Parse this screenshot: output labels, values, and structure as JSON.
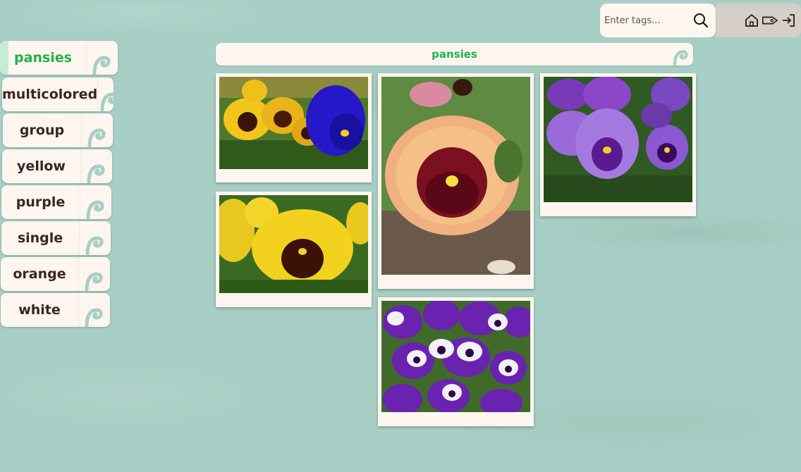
{
  "search": {
    "placeholder": "Enter tags..."
  },
  "toolbar": {
    "icons": [
      "home-icon",
      "tag-icon",
      "sign-in-icon"
    ]
  },
  "tags": [
    {
      "label": "pansies",
      "active": true
    },
    {
      "label": "multicolored",
      "active": false
    },
    {
      "label": "group",
      "active": false
    },
    {
      "label": "yellow",
      "active": false
    },
    {
      "label": "purple",
      "active": false
    },
    {
      "label": "single",
      "active": false
    },
    {
      "label": "orange",
      "active": false
    },
    {
      "label": "white",
      "active": false
    }
  ],
  "gallery": {
    "title": "pansies",
    "photos": [
      {
        "subject": "multicolored pansies yellow and blue"
      },
      {
        "subject": "yellow pansy"
      },
      {
        "subject": "orange peach pansy single"
      },
      {
        "subject": "group of purple and white pansies"
      },
      {
        "subject": "purple pansies"
      }
    ]
  },
  "colors": {
    "background": "#a8cfc5",
    "card": "#fff6ef",
    "accent_green": "#22b04a",
    "tag_text": "#3b2520"
  }
}
